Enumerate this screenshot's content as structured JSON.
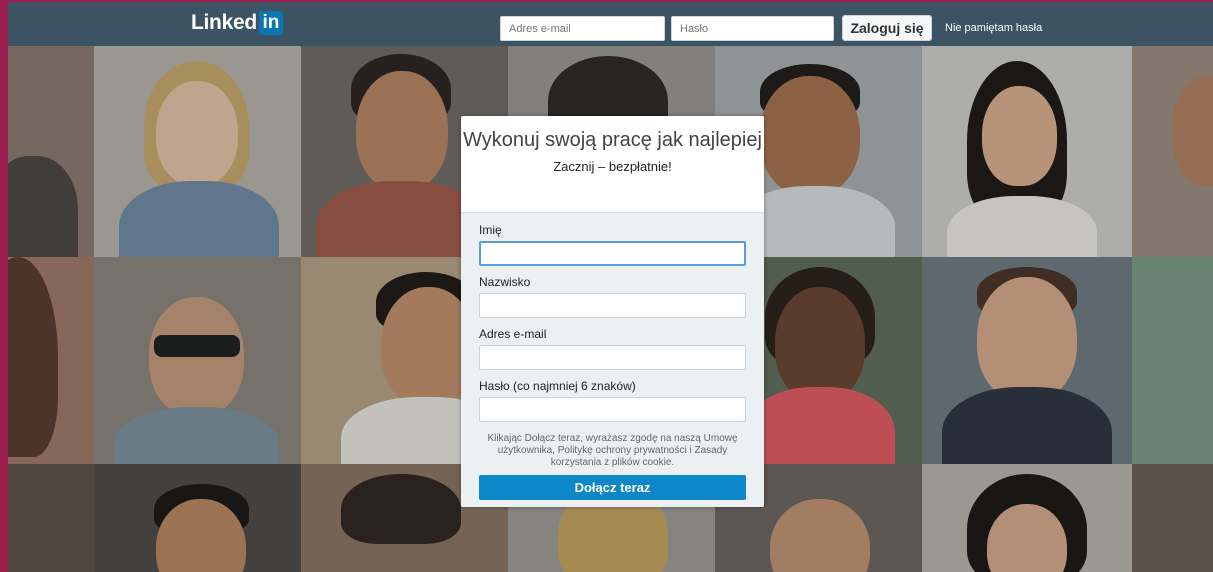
{
  "header": {
    "logo_text": "Linked",
    "logo_badge": "in",
    "email_placeholder": "Adres e-mail",
    "password_placeholder": "Hasło",
    "login_label": "Zaloguj się",
    "forgot_label": "Nie pamiętam hasła"
  },
  "signup": {
    "title": "Wykonuj swoją pracę jak najlepiej",
    "subtitle": "Zacznij – bezpłatnie!",
    "first_name_label": "Imię",
    "last_name_label": "Nazwisko",
    "email_label": "Adres e-mail",
    "password_label": "Hasło (co najmniej 6 znaków)",
    "legal_text": "Klikając Dołącz teraz, wyrażasz zgodę na naszą Umowę użytkownika, Politykę ochrony prywatności i Zasady korzystania z plików cookie.",
    "join_label": "Dołącz teraz"
  },
  "colors": {
    "frame": "#9c1f4f",
    "topbar": "#3c5364",
    "brand_badge": "#0a77b5",
    "join_button": "#0e87c8"
  }
}
